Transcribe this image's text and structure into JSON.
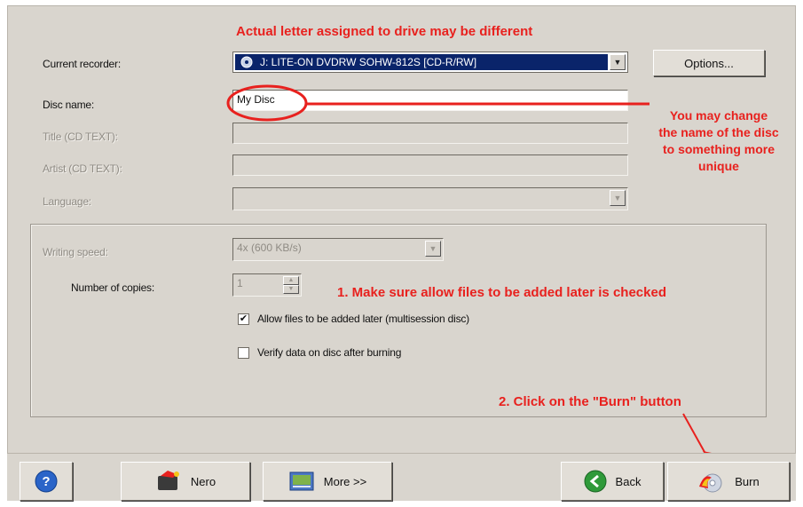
{
  "labels": {
    "current_recorder": "Current recorder:",
    "disc_name": "Disc name:",
    "title_cd_text": "Title (CD TEXT):",
    "artist_cd_text": "Artist (CD TEXT):",
    "language": "Language:",
    "writing_speed": "Writing speed:",
    "number_of_copies": "Number of copies:"
  },
  "recorder": {
    "selected": "J: LITE-ON  DVDRW SOHW-812S   [CD-R/RW]"
  },
  "options_button": "Options...",
  "disc_name_value": "My Disc",
  "writing_speed_value": "4x (600 KB/s)",
  "copies_value": "1",
  "checkboxes": {
    "allow_files": {
      "label": "Allow files to be added later (multisession disc)",
      "checked": true,
      "mark": "✔"
    },
    "verify": {
      "label": "Verify data on disc after burning",
      "checked": false,
      "mark": ""
    }
  },
  "buttons": {
    "help": "?",
    "nero": "Nero",
    "more": "More >>",
    "back": "Back",
    "burn": "Burn"
  },
  "annotations": {
    "drive_letter": "Actual letter assigned to drive may be different",
    "change_name": [
      "You may change",
      "the name of the disc",
      "to something more",
      "unique"
    ],
    "allow_files": "1. Make sure allow files to be added later is checked",
    "burn": "2. Click on the \"Burn\" button"
  },
  "colors": {
    "annotation": "#e8211e",
    "selection": "#0a246a",
    "dialog": "#d9d5ce"
  }
}
